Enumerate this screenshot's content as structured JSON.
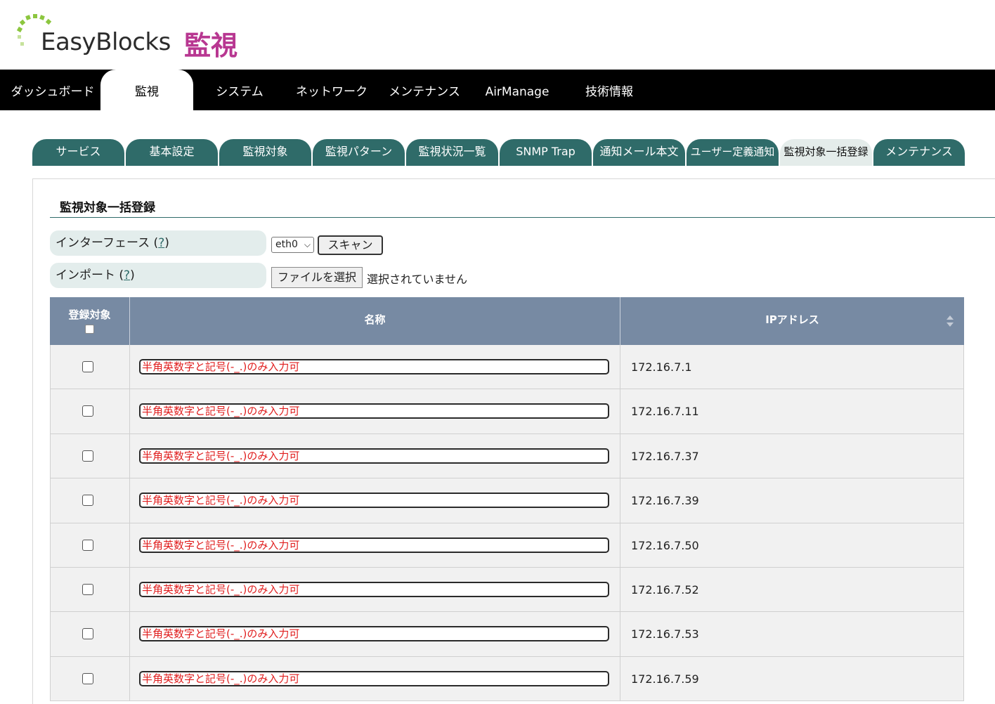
{
  "header": {
    "brand": "EasyBlocks",
    "product": "監視"
  },
  "main_nav": {
    "items": [
      {
        "label": "ダッシュボード"
      },
      {
        "label": "監視"
      },
      {
        "label": "システム"
      },
      {
        "label": "ネットワーク"
      },
      {
        "label": "メンテナンス"
      },
      {
        "label": "AirManage"
      },
      {
        "label": "技術情報"
      }
    ],
    "active_label": "監視"
  },
  "sub_tabs": {
    "items": [
      {
        "label": "サービス"
      },
      {
        "label": "基本設定"
      },
      {
        "label": "監視対象"
      },
      {
        "label": "監視パターン"
      },
      {
        "label": "監視状況一覧"
      },
      {
        "label": "SNMP Trap"
      },
      {
        "label": "通知メール本文"
      },
      {
        "label": "ユーザー定義通知"
      },
      {
        "label": "監視対象一括登録"
      },
      {
        "label": "メンテナンス"
      }
    ],
    "active_label": "監視対象一括登録"
  },
  "page": {
    "title": "監視対象一括登録",
    "interface": {
      "label": "インターフェース",
      "help": "?",
      "selected": "eth0",
      "scan_button": "スキャン"
    },
    "import": {
      "label": "インポート",
      "help": "?",
      "file_button": "ファイルを選択",
      "file_status": "選択されていません"
    }
  },
  "table": {
    "columns": {
      "register": "登録対象",
      "name": "名称",
      "ip": "IPアドレス"
    },
    "rows": [
      {
        "name_placeholder": "半角英数字と記号(-_.)のみ入力可",
        "ip": "172.16.7.1",
        "checked": false
      },
      {
        "name_placeholder": "半角英数字と記号(-_.)のみ入力可",
        "ip": "172.16.7.11",
        "checked": false
      },
      {
        "name_placeholder": "半角英数字と記号(-_.)のみ入力可",
        "ip": "172.16.7.37",
        "checked": false
      },
      {
        "name_placeholder": "半角英数字と記号(-_.)のみ入力可",
        "ip": "172.16.7.39",
        "checked": false
      },
      {
        "name_placeholder": "半角英数字と記号(-_.)のみ入力可",
        "ip": "172.16.7.50",
        "checked": false
      },
      {
        "name_placeholder": "半角英数字と記号(-_.)のみ入力可",
        "ip": "172.16.7.52",
        "checked": false
      },
      {
        "name_placeholder": "半角英数字と記号(-_.)のみ入力可",
        "ip": "172.16.7.53",
        "checked": false
      },
      {
        "name_placeholder": "半角英数字と記号(-_.)のみ入力可",
        "ip": "172.16.7.59",
        "checked": false
      }
    ]
  },
  "colors": {
    "nav_bg": "#000000",
    "tab_bg": "#2f6b69",
    "tab_active_bg": "#e4ecea",
    "table_header_bg": "#778aa3",
    "brand_accent": "#b83791",
    "placeholder_text": "#e01e1e",
    "logo_green": "#8cc63f"
  }
}
